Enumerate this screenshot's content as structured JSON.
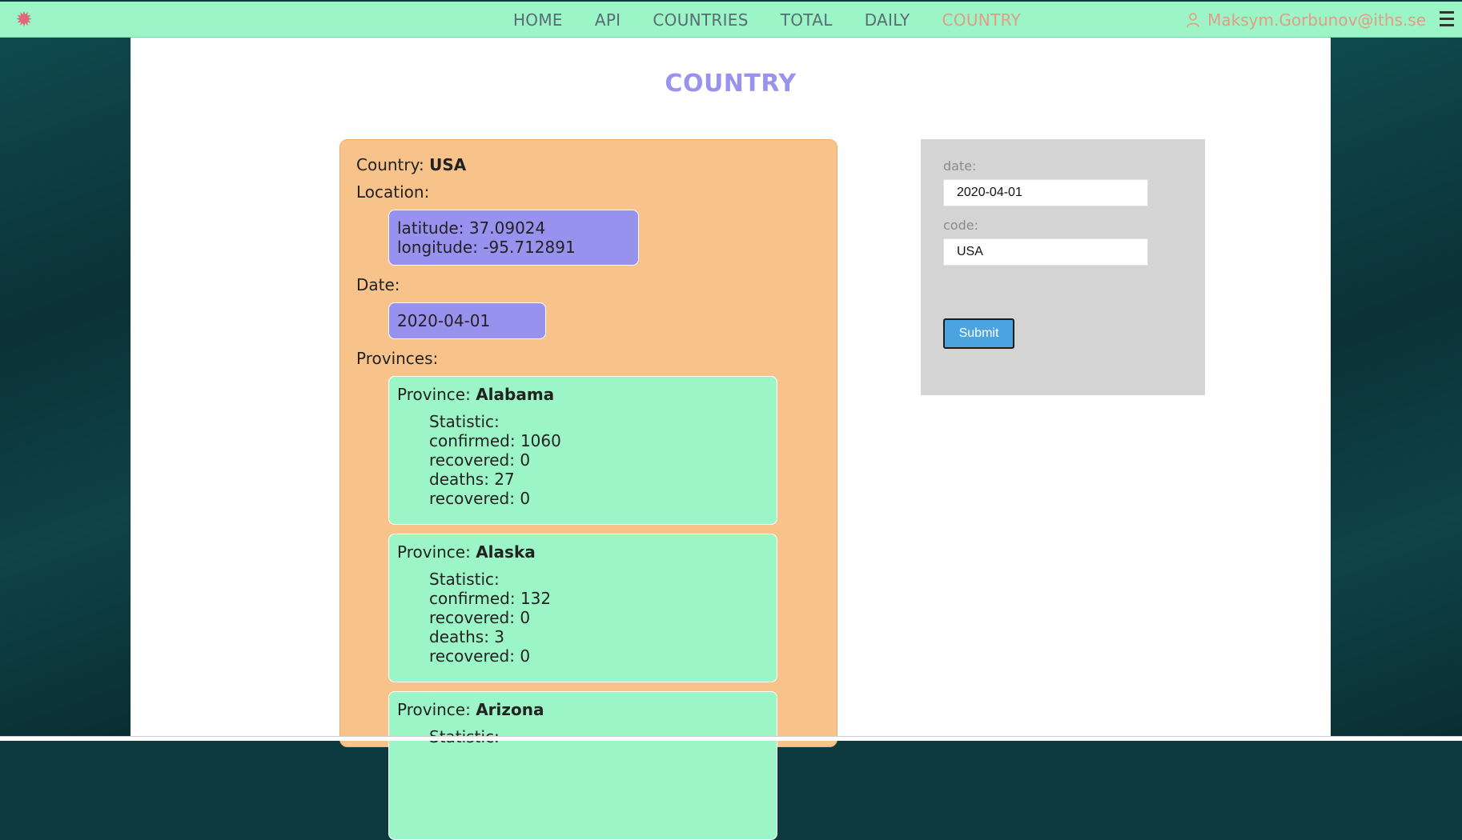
{
  "nav": {
    "logo_icon": "gear-icon",
    "links": [
      "HOME",
      "API",
      "COUNTRIES",
      "TOTAL",
      "DAILY",
      "COUNTRY"
    ],
    "active": "COUNTRY",
    "user_email": "Maksym.Gorbunov@iths.se",
    "user_icon": "user-icon",
    "menu_icon": "hamburger-menu-icon"
  },
  "page": {
    "title": "COUNTRY"
  },
  "country_card": {
    "country_label": "Country: ",
    "country_value": "USA",
    "location_label": "Location:",
    "latitude": "latitude: 37.09024",
    "longitude": "longitude: -95.712891",
    "date_label": "Date:",
    "date_value": "2020-04-01",
    "provinces_label": "Provinces:",
    "province_prefix": "Province: ",
    "statistic_label": "Statistic:",
    "provinces": [
      {
        "name": "Alabama",
        "confirmed": "confirmed: 1060",
        "recovered": "recovered: 0",
        "deaths": "deaths: 27",
        "recovered2": "recovered: 0"
      },
      {
        "name": "Alaska",
        "confirmed": "confirmed: 132",
        "recovered": "recovered: 0",
        "deaths": "deaths: 3",
        "recovered2": "recovered: 0"
      },
      {
        "name": "Arizona",
        "statistic_partial": "Statistic:"
      }
    ]
  },
  "form": {
    "date_label": "date:",
    "date_value": "2020-04-01",
    "code_label": "code:",
    "code_value": "USA",
    "submit_label": "Submit"
  },
  "colors": {
    "navbar": "#9bf5c7",
    "active_link": "#e79a86",
    "title": "#9a93ee",
    "card": "#f8c38a",
    "purple_box": "#9792ee",
    "province_box": "#9bf5c7",
    "form_panel": "#d4d4d4",
    "submit_button": "#4ba3df"
  }
}
